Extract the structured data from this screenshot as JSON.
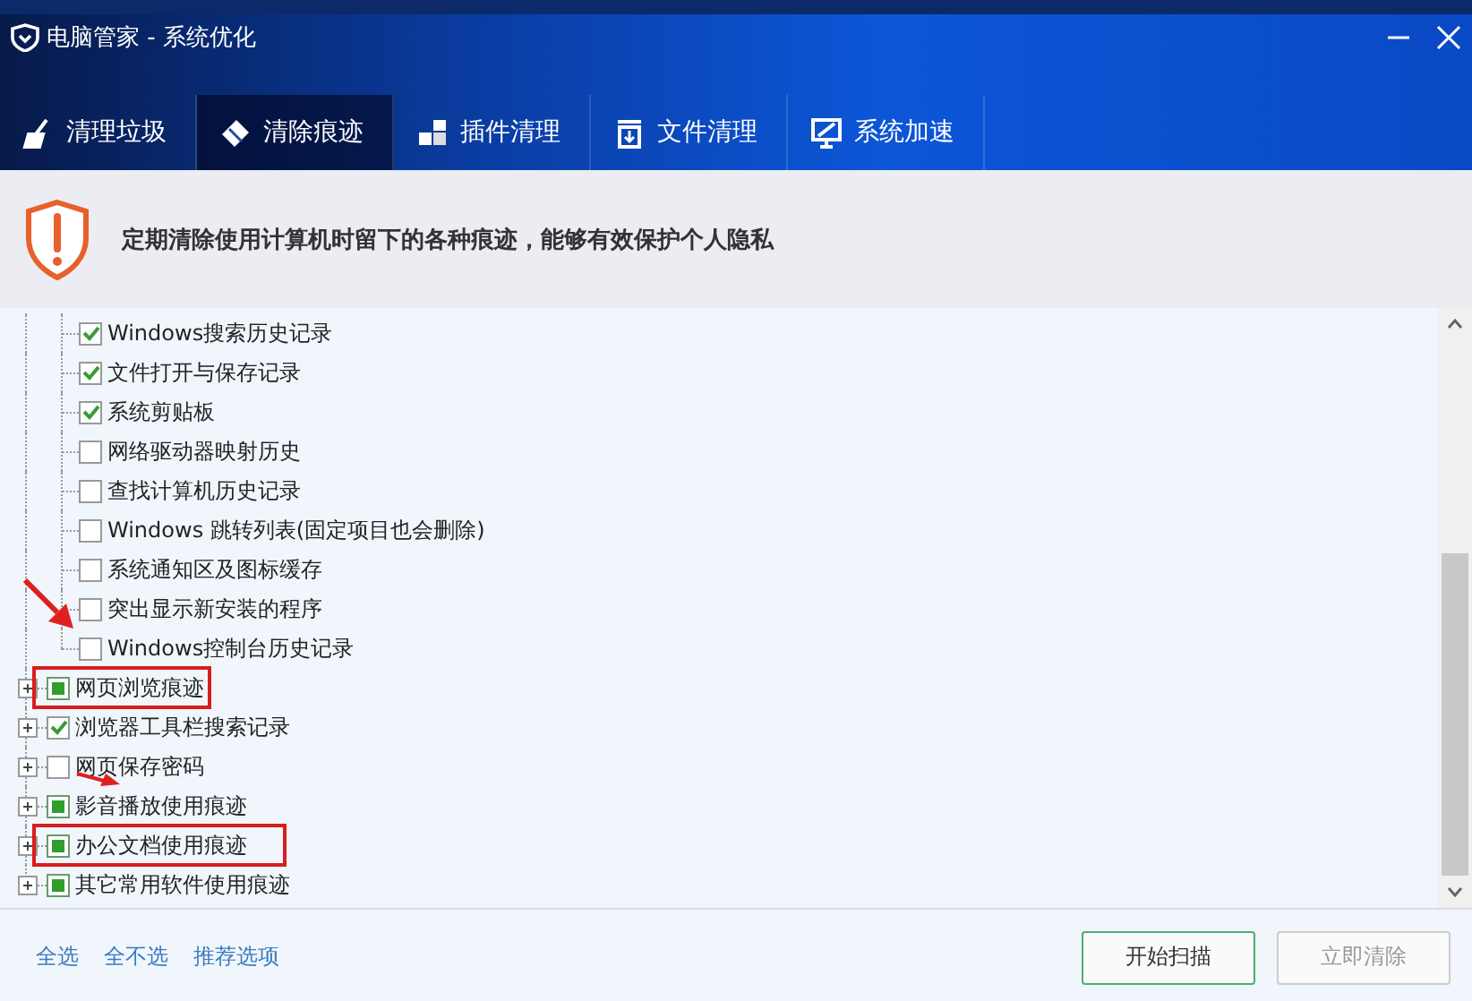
{
  "window": {
    "title": "电脑管家 - 系统优化"
  },
  "tabs": [
    {
      "label": "清理垃圾",
      "selected": false
    },
    {
      "label": "清除痕迹",
      "selected": true
    },
    {
      "label": "插件清理",
      "selected": false
    },
    {
      "label": "文件清理",
      "selected": false
    },
    {
      "label": "系统加速",
      "selected": false
    }
  ],
  "banner": {
    "text": "定期清除使用计算机时留下的各种痕迹，能够有效保护个人隐私"
  },
  "tree": [
    {
      "kind": "item",
      "label": "Windows搜索历史记录",
      "checked": true,
      "partial": false
    },
    {
      "kind": "item",
      "label": "文件打开与保存记录",
      "checked": true,
      "partial": false
    },
    {
      "kind": "item",
      "label": "系统剪贴板",
      "checked": true,
      "partial": false
    },
    {
      "kind": "item",
      "label": "网络驱动器映射历史",
      "checked": false,
      "partial": false
    },
    {
      "kind": "item",
      "label": "查找计算机历史记录",
      "checked": false,
      "partial": false
    },
    {
      "kind": "item",
      "label": "Windows 跳转列表(固定项目也会删除)",
      "checked": false,
      "partial": false
    },
    {
      "kind": "item",
      "label": "系统通知区及图标缓存",
      "checked": false,
      "partial": false
    },
    {
      "kind": "item",
      "label": "突出显示新安装的程序",
      "checked": false,
      "partial": false
    },
    {
      "kind": "item",
      "label": "Windows控制台历史记录",
      "checked": false,
      "partial": false
    },
    {
      "kind": "group",
      "label": "网页浏览痕迹",
      "checked": false,
      "partial": true,
      "expanded": false,
      "highlighted": true
    },
    {
      "kind": "group",
      "label": "浏览器工具栏搜索记录",
      "checked": true,
      "partial": false,
      "expanded": false,
      "highlighted": false
    },
    {
      "kind": "group",
      "label": "网页保存密码",
      "checked": false,
      "partial": false,
      "expanded": false,
      "highlighted": false
    },
    {
      "kind": "group",
      "label": "影音播放使用痕迹",
      "checked": false,
      "partial": true,
      "expanded": false,
      "highlighted": false
    },
    {
      "kind": "group",
      "label": "办公文档使用痕迹",
      "checked": false,
      "partial": true,
      "expanded": false,
      "highlighted": true
    },
    {
      "kind": "group",
      "label": "其它常用软件使用痕迹",
      "checked": false,
      "partial": true,
      "expanded": false,
      "highlighted": false
    }
  ],
  "footer_links": [
    "全选",
    "全不选",
    "推荐选项"
  ],
  "buttons": [
    {
      "label": "开始扫描",
      "disabled": false
    },
    {
      "label": "立即清除",
      "disabled": true
    }
  ]
}
